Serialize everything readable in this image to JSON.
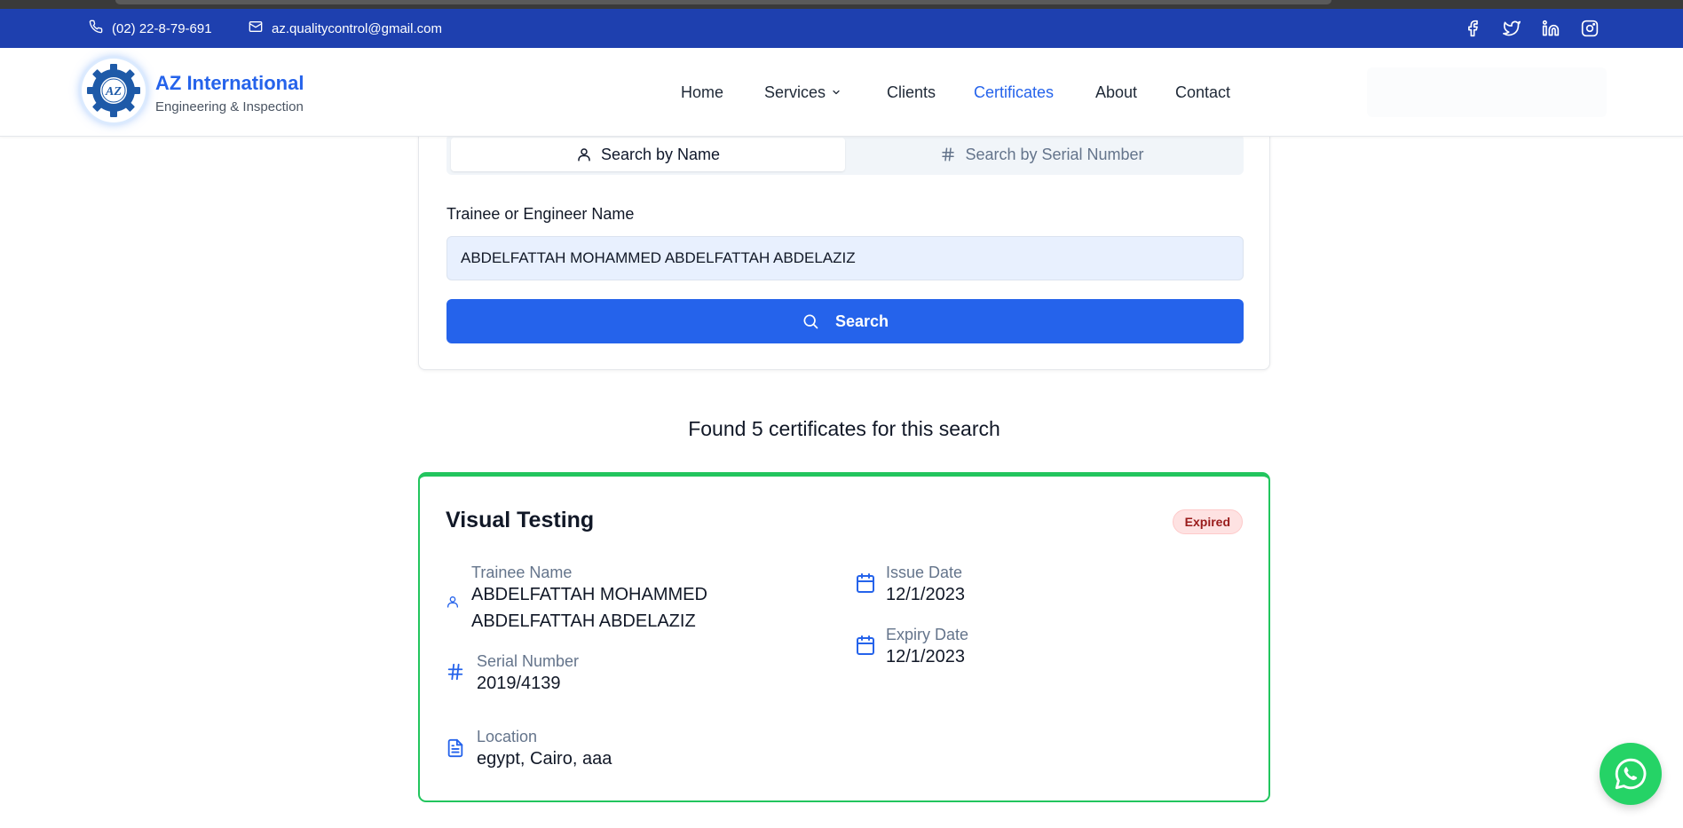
{
  "topbar": {
    "phone": "(02) 22-8-79-691",
    "email": "az.qualitycontrol@gmail.com",
    "social": [
      "facebook-icon",
      "twitter-icon",
      "linkedin-icon",
      "instagram-icon"
    ]
  },
  "brand": {
    "name": "AZ International",
    "tagline": "Engineering & Inspection",
    "logo_text": "AZ",
    "color": "#2563eb"
  },
  "nav": {
    "home": "Home",
    "services": "Services",
    "clients": "Clients",
    "certificates": "Certificates",
    "about": "About",
    "contact": "Contact",
    "active": "Certificates"
  },
  "search": {
    "tab_name": "Search by Name",
    "tab_serial": "Search by Serial Number",
    "active_tab": "Search by Name",
    "field_label": "Trainee or Engineer Name",
    "field_value": "ABDELFATTAH MOHAMMED ABDELFATTAH ABDELAZIZ",
    "button_label": "Search"
  },
  "results": {
    "summary": "Found 5 certificates for this search",
    "certificates": [
      {
        "title": "Visual Testing",
        "status": "Expired",
        "trainee_label": "Trainee Name",
        "trainee_line1": "ABDELFATTAH MOHAMMED",
        "trainee_line2": "ABDELFATTAH ABDELAZIZ",
        "serial_label": "Serial Number",
        "serial": "2019/4139",
        "location_label": "Location",
        "location": "egypt, Cairo, aaa",
        "issue_label": "Issue Date",
        "issue_date": "12/1/2023",
        "expiry_label": "Expiry Date",
        "expiry_date": "12/1/2023"
      }
    ]
  },
  "colors": {
    "topbar": "#1e40af",
    "primary": "#2563eb",
    "valid_border": "#22c55e",
    "expired_badge": "#fee2e2",
    "whatsapp": "#25d366"
  }
}
